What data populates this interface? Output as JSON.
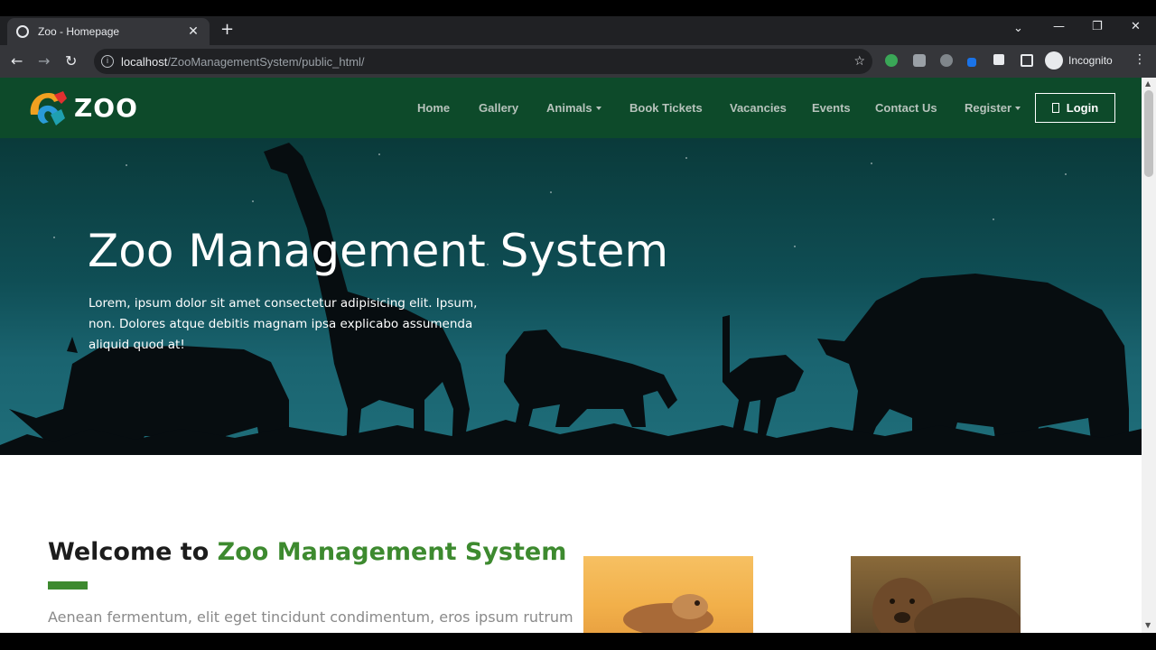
{
  "browser": {
    "tab_title": "Zoo - Homepage",
    "tab_close_glyph": "✕",
    "new_tab_glyph": "+",
    "url_host": "localhost",
    "url_path": "/ZooManagementSystem/public_html/",
    "profile_label": "Incognito",
    "icons": [
      "globe-icon",
      "back-icon",
      "forward-icon",
      "reload-icon",
      "info-icon",
      "star-icon",
      "extensions-icon",
      "incognito-icon",
      "menu-icon"
    ]
  },
  "site": {
    "logo_text": "ZOO",
    "nav": [
      {
        "label": "Home",
        "dropdown": false
      },
      {
        "label": "Gallery",
        "dropdown": false
      },
      {
        "label": "Animals",
        "dropdown": true
      },
      {
        "label": "Book Tickets",
        "dropdown": false
      },
      {
        "label": "Vacancies",
        "dropdown": false
      },
      {
        "label": "Events",
        "dropdown": false
      },
      {
        "label": "Contact Us",
        "dropdown": false
      },
      {
        "label": "Register",
        "dropdown": true
      }
    ],
    "login_label": "Login",
    "colors": {
      "nav_bg": "#0d4a2a",
      "accent_green": "#3d8a2f"
    }
  },
  "hero": {
    "title": "Zoo Management System",
    "text": "Lorem, ipsum dolor sit amet consectetur adipisicing elit. Ipsum, non. Dolores atque debitis magnam ipsa explicabo assumenda aliquid quod at!"
  },
  "welcome": {
    "prefix": "Welcome to ",
    "accent": "Zoo Management System",
    "lead": "Aenean fermentum, elit eget tincidunt condimentum, eros ipsum rutrum"
  }
}
